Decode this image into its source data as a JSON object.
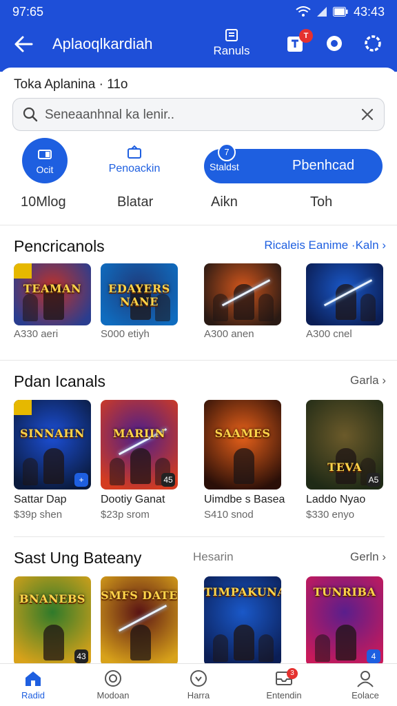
{
  "status_bar": {
    "time": "97:65",
    "clock": "43:43"
  },
  "header": {
    "title": "Aplaoqlkardiah",
    "center_tab_label": "Ranuls",
    "cart_badge": "T"
  },
  "search_section": {
    "label": "Toka Aplanina · 11o",
    "placeholder": "Seneaanhnal ka lenir.."
  },
  "quick_actions": {
    "circle_label": "Ocit",
    "middle_label": "Penoackin",
    "pill_left": "Staldst",
    "pill_right": "Pbenhcad",
    "pill_badge": "7"
  },
  "filters": [
    "10Mlog",
    "Blatar",
    "Aikn",
    "Toh"
  ],
  "sections": [
    {
      "title": "Pencricanols",
      "link": "Ricaleis Eanime ·Kaln",
      "items": [
        {
          "thumb_text": "TEAMAN",
          "price": "A330 aeri",
          "colors": [
            "#c03228",
            "#2a3d8f"
          ]
        },
        {
          "thumb_text": "EDAYERS NANE",
          "price": "S000 etiyh",
          "colors": [
            "#1f3a7a",
            "#0f6cbf"
          ]
        },
        {
          "thumb_text": "",
          "price": "A300 anen",
          "colors": [
            "#d2561c",
            "#2a1a14"
          ]
        },
        {
          "thumb_text": "",
          "price": "A300 cnel",
          "colors": [
            "#1a58c8",
            "#0b1e55"
          ]
        }
      ]
    },
    {
      "title": "Pdan Icanals",
      "link": "Garla",
      "items": [
        {
          "thumb_text": "SINNAHN",
          "name": "Sattar Dap",
          "price": "$39p shen",
          "colors": [
            "#1c4fd6",
            "#0a1a3c"
          ],
          "badge": "+"
        },
        {
          "thumb_text": "MARIIN",
          "name": "Dootiy Ganat",
          "price": "$23p srom",
          "colors": [
            "#4a1e8c",
            "#d43c20"
          ],
          "badge": "45"
        },
        {
          "thumb_text": "SAAMES",
          "name": "Uimdbe s Basea",
          "price": "S410 snod",
          "colors": [
            "#e8611a",
            "#2a0f08"
          ]
        },
        {
          "thumb_text": "TEVA",
          "name": "Laddo Nyao",
          "price": "$330 enyo",
          "colors": [
            "#6b5a2a",
            "#1f2a16"
          ],
          "badge": "A5"
        }
      ]
    },
    {
      "title": "Sast Ung Bateany",
      "mid": "Hesarin",
      "link": "Gerln",
      "items": [
        {
          "thumb_text": "BNANEBS",
          "colors": [
            "#2f7a2a",
            "#d8a21a"
          ],
          "badge": "43"
        },
        {
          "thumb_text": "SMFS DATE",
          "colors": [
            "#5a1414",
            "#d8a21a"
          ]
        },
        {
          "thumb_text": "TIMPAKUNA",
          "colors": [
            "#1a58c8",
            "#0b1e55"
          ]
        },
        {
          "thumb_text": "TUNRIBA",
          "colors": [
            "#5a1e8c",
            "#c81a5a"
          ],
          "badge": "4"
        }
      ]
    }
  ],
  "bottom_nav": [
    {
      "label": "Radid",
      "icon": "home-icon"
    },
    {
      "label": "Modoan",
      "icon": "compass-icon"
    },
    {
      "label": "Harra",
      "icon": "heart-icon"
    },
    {
      "label": "Entendin",
      "icon": "inbox-icon",
      "badge": "3"
    },
    {
      "label": "Eolace",
      "icon": "person-icon"
    }
  ],
  "colors": {
    "brand": "#1e4fd8",
    "accent": "#1e5fe0",
    "badge": "#e5312f"
  }
}
